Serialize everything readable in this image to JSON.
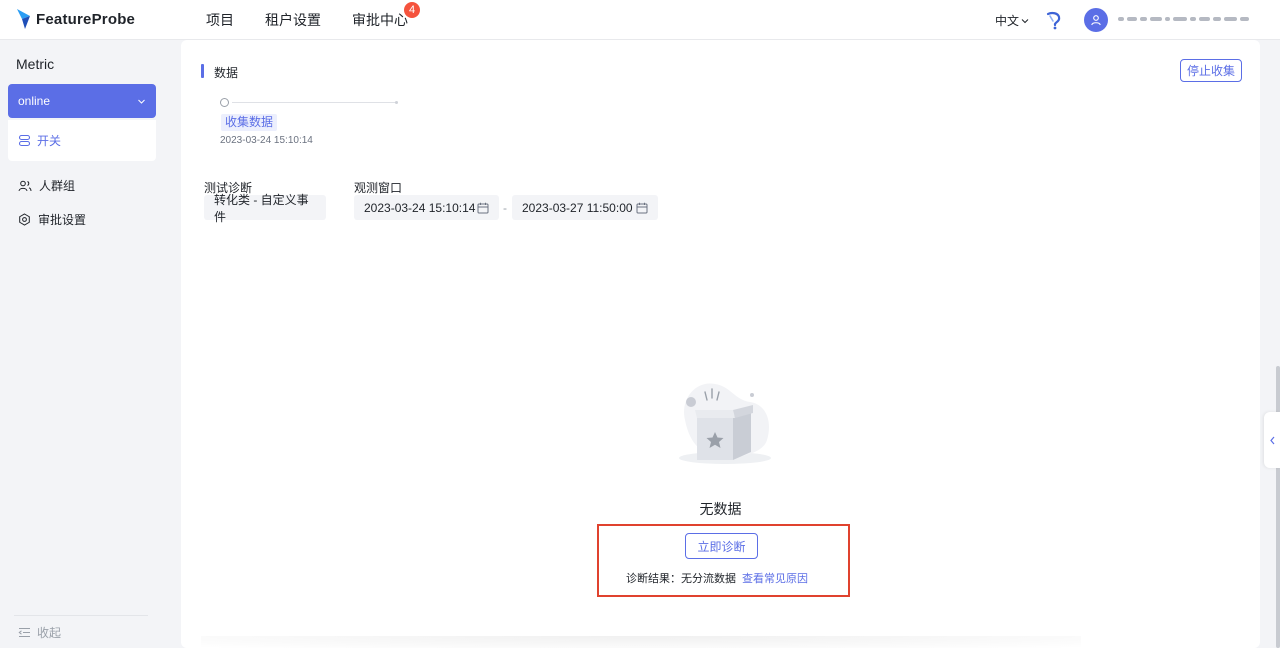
{
  "app": {
    "logo_text": "FeatureProbe"
  },
  "nav": {
    "items": [
      {
        "label": "项目"
      },
      {
        "label": "租户设置"
      },
      {
        "label": "审批中心",
        "badge": "4"
      }
    ]
  },
  "header": {
    "language": "中文"
  },
  "sidebar": {
    "title": "Metric",
    "env_select": "online",
    "active_item": "开关",
    "items": [
      {
        "label": "人群组"
      },
      {
        "label": "审批设置"
      }
    ],
    "collapse_label": "收起"
  },
  "main": {
    "section_title": "数据",
    "stop_button": "停止收集",
    "step": {
      "label": "收集数据",
      "time": "2023-03-24 15:10:14"
    },
    "test_diagnosis": {
      "label": "测试诊断",
      "value": "转化类 - 自定义事件"
    },
    "observation_window": {
      "label": "观测窗口",
      "start": "2023-03-24 15:10:14",
      "separator": "-",
      "end": "2023-03-27 11:50:00"
    },
    "empty": {
      "text": "无数据",
      "diagnose_button": "立即诊断",
      "result_label": "诊断结果：无分流数据",
      "result_link": "查看常见原因"
    }
  },
  "colors": {
    "accent": "#5b6ee6",
    "badge": "#f5533d",
    "highlight": "#e0422e"
  }
}
